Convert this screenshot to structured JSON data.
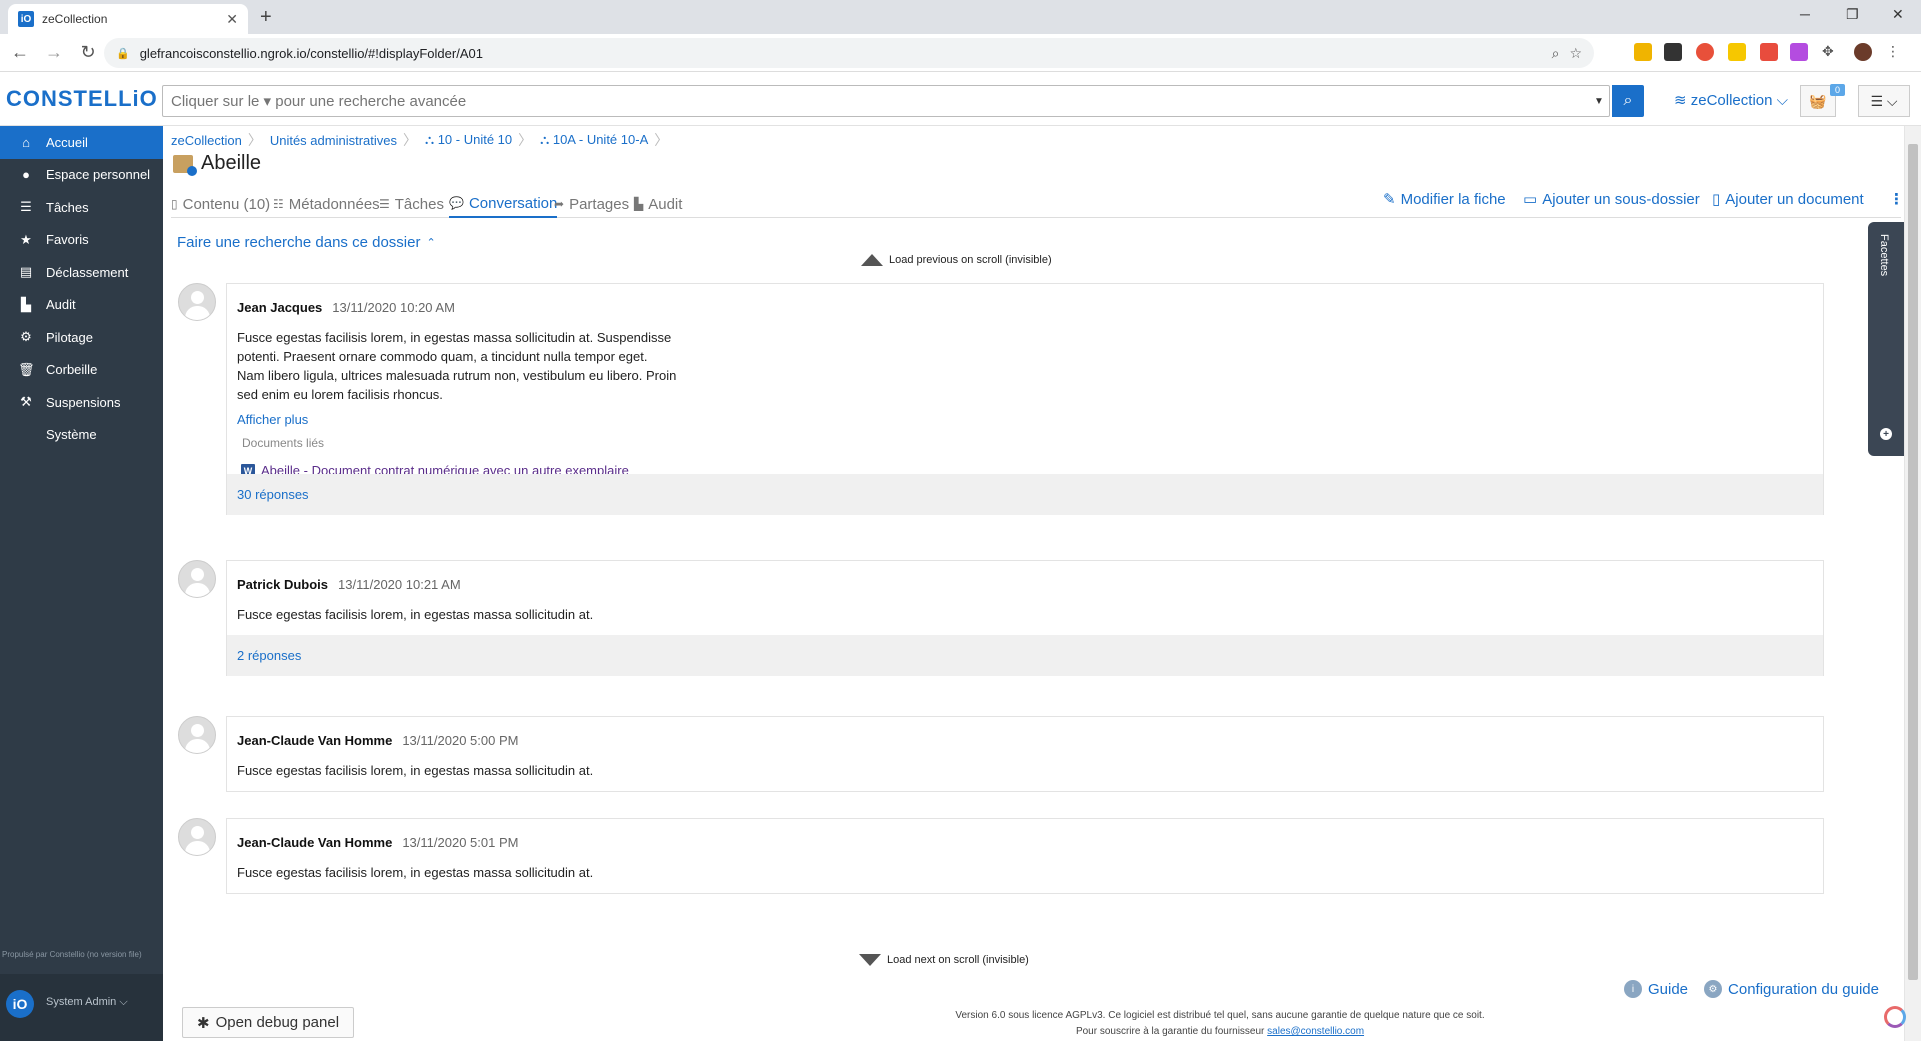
{
  "browser": {
    "tab_title": "zeCollection",
    "tab_favicon": "iO",
    "url": "glefrancoisconstellio.ngrok.io/constellio/#!displayFolder/A01"
  },
  "header": {
    "logo": "CONSTELLiO",
    "search_placeholder": "Cliquer sur le ▾ pour une recherche avancée",
    "collection": "zeCollection",
    "cart_count": "0"
  },
  "sidebar": {
    "items": [
      {
        "label": "Accueil",
        "icon": "home-icon",
        "glyph": "⌂"
      },
      {
        "label": "Espace personnel",
        "icon": "user-icon",
        "glyph": "●"
      },
      {
        "label": "Tâches",
        "icon": "list-icon",
        "glyph": "☰"
      },
      {
        "label": "Favoris",
        "icon": "star-icon",
        "glyph": "★"
      },
      {
        "label": "Déclassement",
        "icon": "archive-icon",
        "glyph": "▤"
      },
      {
        "label": "Audit",
        "icon": "chart-icon",
        "glyph": "▙"
      },
      {
        "label": "Pilotage",
        "icon": "gears-icon",
        "glyph": "⚙"
      },
      {
        "label": "Corbeille",
        "icon": "trash-icon",
        "glyph": "🗑"
      },
      {
        "label": "Suspensions",
        "icon": "gavel-icon",
        "glyph": "⚒"
      },
      {
        "label": "Système",
        "icon": "",
        "glyph": ""
      }
    ],
    "powered_by": "Propulsé par Constellio (no version file)",
    "user_avatar": "iO",
    "user_name": "System Admin ⌵"
  },
  "breadcrumb": [
    {
      "label": "zeCollection"
    },
    {
      "label": "Unités administratives"
    },
    {
      "label": "⛬ 10 - Unité 10"
    },
    {
      "label": "⛬ 10A - Unité 10-A"
    }
  ],
  "folder": {
    "title": "Abeille"
  },
  "tabs": [
    {
      "label": "Contenu (10)",
      "glyph": "▯"
    },
    {
      "label": "Métadonnées",
      "glyph": "☷"
    },
    {
      "label": "Tâches",
      "glyph": "☰"
    },
    {
      "label": "Conversation",
      "glyph": "💬"
    },
    {
      "label": "Partages",
      "glyph": "➦"
    },
    {
      "label": "Audit",
      "glyph": "▙"
    }
  ],
  "actions": {
    "edit": "Modifier la fiche",
    "add_subfolder": "Ajouter un sous-dossier",
    "add_document": "Ajouter un document",
    "more": "⋮"
  },
  "search_in_folder": "Faire une recherche dans ce dossier",
  "load_previous": "Load previous on scroll (invisible)",
  "load_next": "Load next on scroll (invisible)",
  "messages": [
    {
      "author": "Jean Jacques",
      "time": "13/11/2020 10:20 AM",
      "text": "Fusce egestas facilisis lorem, in egestas massa sollicitudin at. Suspendisse potenti. Praesent ornare commodo quam, a tincidunt nulla tempor eget. Nam libero ligula, ultrices malesuada rutrum non, vestibulum eu libero. Proin sed enim eu lorem facilisis rhoncus.",
      "show_more": "Afficher plus",
      "linked_label": "Documents liés",
      "linked_doc": "Abeille - Document contrat numérique avec un autre exemplaire",
      "replies": "30 réponses"
    },
    {
      "author": "Patrick Dubois",
      "time": "13/11/2020 10:21 AM",
      "text": "Fusce egestas facilisis lorem, in egestas massa sollicitudin at.",
      "replies": "2 réponses"
    },
    {
      "author": "Jean-Claude Van Homme",
      "time": "13/11/2020 5:00 PM",
      "text": "Fusce egestas facilisis lorem, in egestas massa sollicitudin at."
    },
    {
      "author": "Jean-Claude Van Homme",
      "time": "13/11/2020 5:01 PM",
      "text": "Fusce egestas facilisis lorem, in egestas massa sollicitudin at."
    }
  ],
  "facets_label": "Facettes",
  "guide": {
    "guide": "Guide",
    "config": "Configuration du guide"
  },
  "debug_button": "Open debug panel",
  "footer": {
    "line1": "Version 6.0 sous licence AGPLv3. Ce logiciel est distribué tel quel, sans aucune garantie de quelque nature que ce soit.",
    "line2": "Pour souscrire à la garantie du fournisseur",
    "email": "sales@constellio.com"
  }
}
